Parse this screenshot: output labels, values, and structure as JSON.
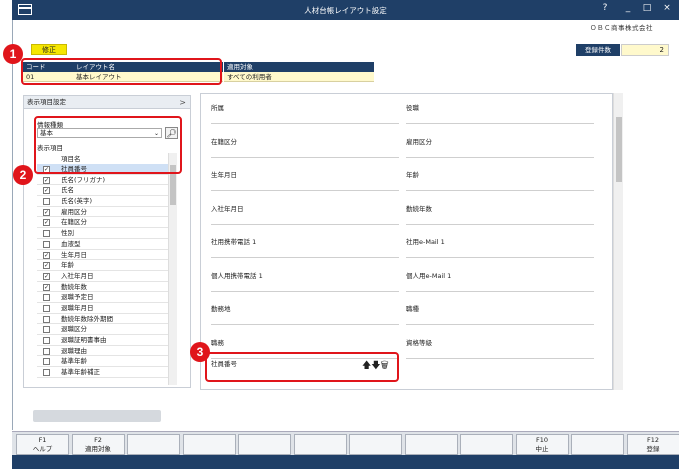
{
  "window": {
    "title": "人材台帳レイアウト設定",
    "controls": [
      "?",
      "_",
      "□",
      "×"
    ],
    "company": "ＯＢＣ商事株式会社"
  },
  "toolbar": {
    "edit_label": "修正",
    "count_label": "登録件数",
    "count_value": "2"
  },
  "layout_table": {
    "headers": [
      "コード",
      "レイアウト名",
      "適用対象"
    ],
    "row": {
      "code": "01",
      "name": "基本レイアウト",
      "target": "すべての利用者"
    }
  },
  "left_panel": {
    "title": "表示項目設定",
    "category_label": "情報種類",
    "category_value": "基本",
    "items_label": "表示項目",
    "list_header": "項目名",
    "items": [
      {
        "label": "社員番号",
        "checked": true
      },
      {
        "label": "氏名(フリガナ)",
        "checked": true
      },
      {
        "label": "氏名",
        "checked": true
      },
      {
        "label": "氏名(英字)",
        "checked": false
      },
      {
        "label": "雇用区分",
        "checked": true
      },
      {
        "label": "在籍区分",
        "checked": true
      },
      {
        "label": "性別",
        "checked": false
      },
      {
        "label": "血液型",
        "checked": false
      },
      {
        "label": "生年月日",
        "checked": true
      },
      {
        "label": "年齢",
        "checked": true
      },
      {
        "label": "入社年月日",
        "checked": true
      },
      {
        "label": "勤続年数",
        "checked": true
      },
      {
        "label": "退職予定日",
        "checked": false
      },
      {
        "label": "退職年月日",
        "checked": false
      },
      {
        "label": "勤続年数除外期間",
        "checked": false
      },
      {
        "label": "退職区分",
        "checked": false
      },
      {
        "label": "退職証明書事由",
        "checked": false
      },
      {
        "label": "退職理由",
        "checked": false
      },
      {
        "label": "基準年齢",
        "checked": false
      },
      {
        "label": "基準年齢補正",
        "checked": false
      }
    ]
  },
  "right_panel": {
    "fields": [
      [
        "所属",
        "役職"
      ],
      [
        "在籍区分",
        "雇用区分"
      ],
      [
        "生年月日",
        "年齢"
      ],
      [
        "入社年月日",
        "勤続年数"
      ],
      [
        "社用携帯電話 1",
        "社用e-Mail 1"
      ],
      [
        "個人用携帯電話 1",
        "個人用e-Mail 1"
      ],
      [
        "勤務地",
        "職種"
      ],
      [
        "職務",
        "資格等級"
      ]
    ],
    "added_field": "社員番号",
    "icons": [
      "up-arrow-icon",
      "down-arrow-icon",
      "trash-icon"
    ]
  },
  "markers": [
    "1",
    "2",
    "3"
  ],
  "fkeys": [
    {
      "key": "F1",
      "label": "ヘルプ"
    },
    {
      "key": "F2",
      "label": "適用対象"
    },
    {
      "key": "",
      "label": ""
    },
    {
      "key": "",
      "label": ""
    },
    {
      "key": "",
      "label": ""
    },
    {
      "key": "",
      "label": ""
    },
    {
      "key": "",
      "label": ""
    },
    {
      "key": "",
      "label": ""
    },
    {
      "key": "",
      "label": ""
    },
    {
      "key": "F10",
      "label": "中止"
    },
    {
      "key": "",
      "label": ""
    },
    {
      "key": "F12",
      "label": "登録"
    }
  ],
  "colors": {
    "navy": "#1f3f67",
    "accent_yellow": "#f5e600",
    "marker_red": "#e0151b"
  }
}
